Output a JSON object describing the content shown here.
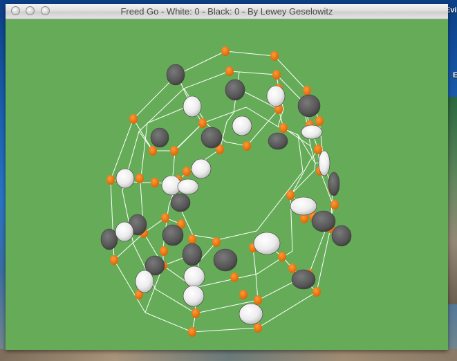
{
  "window": {
    "title": "Freed Go - White: 0 - Black: 0 - By Lewey Geselowitz"
  },
  "score": {
    "white": 0,
    "black": 0
  },
  "desktop": {
    "label_top": "Evi",
    "label_side": "E"
  },
  "board": {
    "background": "#66ac58",
    "line_color": "#ffffff",
    "point_color": "#e36f06",
    "white_stone": "#f2f2f2",
    "black_stone": "#575757"
  }
}
